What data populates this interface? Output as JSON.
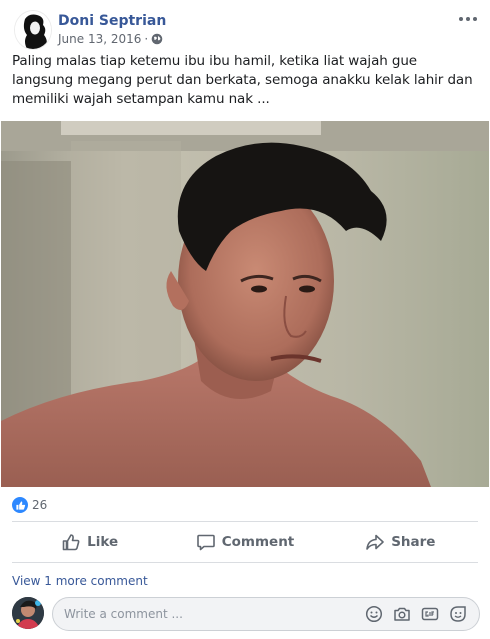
{
  "post": {
    "author": "Doni Septrian",
    "date": "June 13, 2016",
    "separator": "·",
    "privacy_icon": "globe-icon",
    "more_icon": "ellipsis-icon",
    "text": "Paling malas tiap ketemu ibu ibu hamil, ketika liat wajah gue langsung megang perut dan berkata, semoga anakku kelak lahir dan memiliki wajah setampan kamu nak ..."
  },
  "reactions": {
    "icon": "like-reaction-icon",
    "count": "26"
  },
  "actions": [
    {
      "label": "Like",
      "icon": "thumbs-up-icon"
    },
    {
      "label": "Comment",
      "icon": "comment-bubble-icon"
    },
    {
      "label": "Share",
      "icon": "share-arrow-icon"
    }
  ],
  "comments": {
    "view_more": "View 1 more comment",
    "placeholder": "Write a comment ...",
    "tools": [
      "emoji-icon",
      "camera-icon",
      "gif-icon",
      "sticker-icon"
    ]
  },
  "colors": {
    "link": "#385898",
    "muted": "#606770",
    "like_blue": "#2d88ff",
    "divider": "#dadde1"
  }
}
